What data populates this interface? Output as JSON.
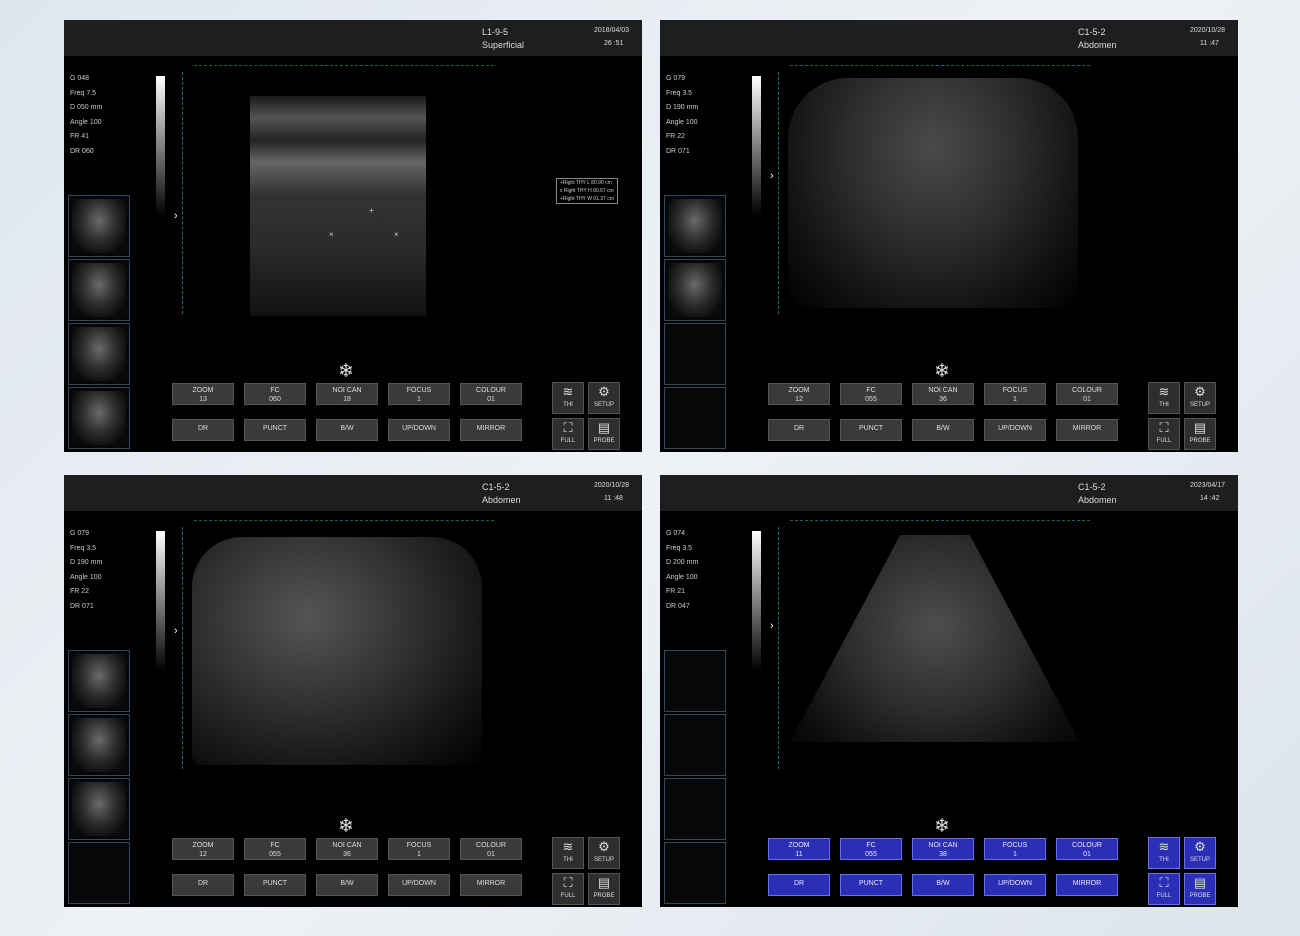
{
  "panels": [
    {
      "probe": "L1-9-5",
      "preset": "Superficial",
      "date": "2018/04/03",
      "time": "26 :51",
      "params": [
        "G 048",
        "Freq 7.5",
        "D 050 mm",
        "Angle 100",
        "FR 41",
        "DR 060"
      ],
      "buttons": [
        [
          "ZOOM",
          "13"
        ],
        [
          "FC",
          "060"
        ],
        [
          "NOI CAN",
          "18"
        ],
        [
          "FOCUS",
          "1"
        ],
        [
          "COLOUR",
          "01"
        ],
        [
          "DR"
        ],
        [
          "PUNCT"
        ],
        [
          "B/W"
        ],
        [
          "UP/DOWN"
        ],
        [
          "MIRROR"
        ]
      ],
      "icons": [
        "THI",
        "SETUP",
        "FULL",
        "PROBE"
      ],
      "measure": [
        "+Right THY L 80.90 cm",
        "x Right THY H 80.67 cm",
        "+Right THY W 01.37 cm"
      ]
    },
    {
      "probe": "C1-5-2",
      "preset": "Abdomen",
      "date": "2020/10/28",
      "time": "11 :47",
      "params": [
        "G 079",
        "Freq 3.5",
        "D 190 mm",
        "Angle 100",
        "FR 22",
        "DR 071"
      ],
      "buttons": [
        [
          "ZOOM",
          "12"
        ],
        [
          "FC",
          "055"
        ],
        [
          "NOI CAN",
          "36"
        ],
        [
          "FOCUS",
          "1"
        ],
        [
          "COLOUR",
          "01"
        ],
        [
          "DR"
        ],
        [
          "PUNCT"
        ],
        [
          "B/W"
        ],
        [
          "UP/DOWN"
        ],
        [
          "MIRROR"
        ]
      ],
      "icons": [
        "THI",
        "SETUP",
        "FULL",
        "PROBE"
      ]
    },
    {
      "probe": "C1-5-2",
      "preset": "Abdomen",
      "date": "2020/10/28",
      "time": "11 :48",
      "params": [
        "G 079",
        "Freq 3.5",
        "D 190 mm",
        "Angle 100",
        "FR 22",
        "DR 071"
      ],
      "buttons": [
        [
          "ZOOM",
          "12"
        ],
        [
          "FC",
          "055"
        ],
        [
          "NOI CAN",
          "36"
        ],
        [
          "FOCUS",
          "1"
        ],
        [
          "COLOUR",
          "01"
        ],
        [
          "DR"
        ],
        [
          "PUNCT"
        ],
        [
          "B/W"
        ],
        [
          "UP/DOWN"
        ],
        [
          "MIRROR"
        ]
      ],
      "icons": [
        "THI",
        "SETUP",
        "FULL",
        "PROBE"
      ]
    },
    {
      "probe": "C1-5-2",
      "preset": "Abdomen",
      "date": "2023/04/17",
      "time": "14 :42",
      "params": [
        "G 074",
        "Freq 3.5",
        "D 200 mm",
        "Angle 100",
        "FR 21",
        "DR 047"
      ],
      "buttons": [
        [
          "ZOOM",
          "11"
        ],
        [
          "FC",
          "055"
        ],
        [
          "NOI CAN",
          "38"
        ],
        [
          "FOCUS",
          "1"
        ],
        [
          "COLOUR",
          "01"
        ],
        [
          "DR"
        ],
        [
          "PUNCT"
        ],
        [
          "B/W"
        ],
        [
          "UP/DOWN"
        ],
        [
          "MIRROR"
        ]
      ],
      "icons": [
        "THI",
        "SETUP",
        "FULL",
        "PROBE"
      ]
    }
  ],
  "freeze_glyph": "❄",
  "colors": {
    "panel_bg": "#000000",
    "header_bg": "#1e1e1e",
    "button_bg": "#3a3a3a",
    "active_button_bg": "#2b2fb8"
  }
}
